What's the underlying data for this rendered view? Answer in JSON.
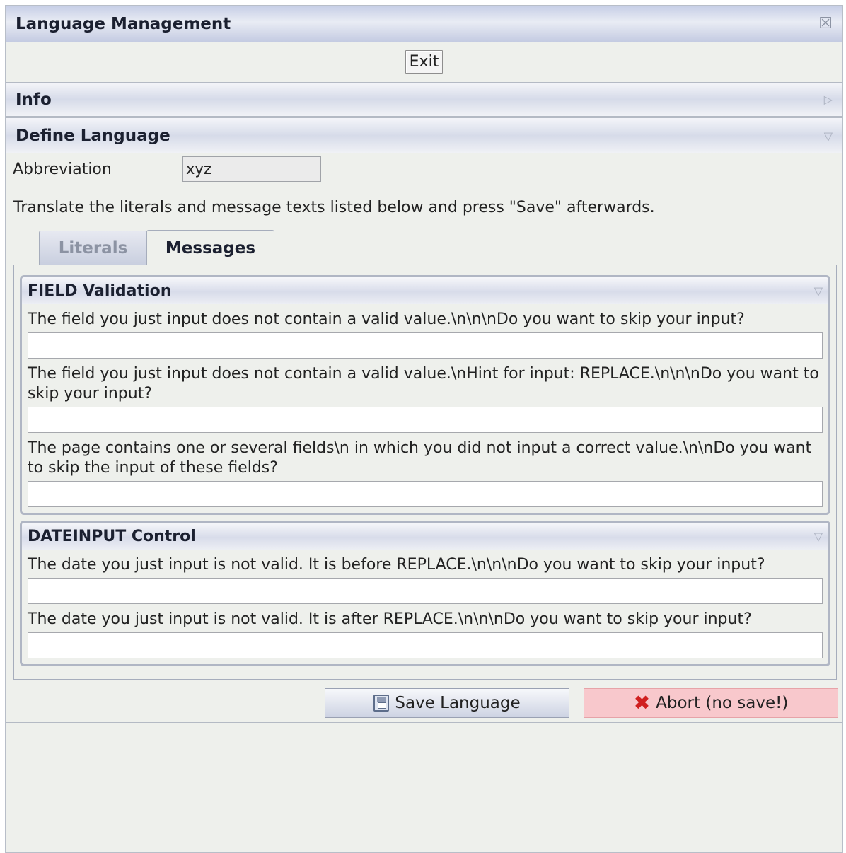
{
  "window": {
    "title": "Language Management"
  },
  "toolbar": {
    "exit_label": "Exit"
  },
  "sections": {
    "info_title": "Info",
    "define_title": "Define Language"
  },
  "define": {
    "abbreviation_label": "Abbreviation",
    "abbreviation_value": "xyz",
    "instruction": "Translate the literals and message texts listed below and press \"Save\" afterwards."
  },
  "tabs": [
    {
      "label": "Literals",
      "selected": false
    },
    {
      "label": "Messages",
      "selected": true
    }
  ],
  "groups": [
    {
      "title": "FIELD Validation",
      "messages": [
        {
          "text": "The field you just input does not contain a valid value.\\n\\n\\nDo you want to skip your input?",
          "value": ""
        },
        {
          "text": "The field you just input does not contain a valid value.\\nHint for input: REPLACE.\\n\\n\\nDo you want to skip your input?",
          "value": ""
        },
        {
          "text": "The page contains one or several fields\\n in which you did not input a correct value.\\n\\nDo you want to skip the input of these fields?",
          "value": ""
        }
      ]
    },
    {
      "title": "DATEINPUT Control",
      "messages": [
        {
          "text": "The date you just input is not valid. It is before REPLACE.\\n\\n\\nDo you want to skip your input?",
          "value": ""
        },
        {
          "text": "The date you just input is not valid. It is after REPLACE.\\n\\n\\nDo you want to skip your input?",
          "value": ""
        }
      ]
    }
  ],
  "actions": {
    "save_label": "Save Language",
    "abort_label": "Abort (no save!)"
  },
  "icons": {
    "close": "close-icon",
    "collapsed": "triangle-right-icon",
    "expanded": "triangle-down-icon",
    "save": "floppy-disk-icon",
    "abort": "red-x-icon"
  },
  "colors": {
    "abort_background": "#f8c8cc",
    "abort_icon": "#d02020",
    "header_gradient": "#d6dbe9"
  }
}
